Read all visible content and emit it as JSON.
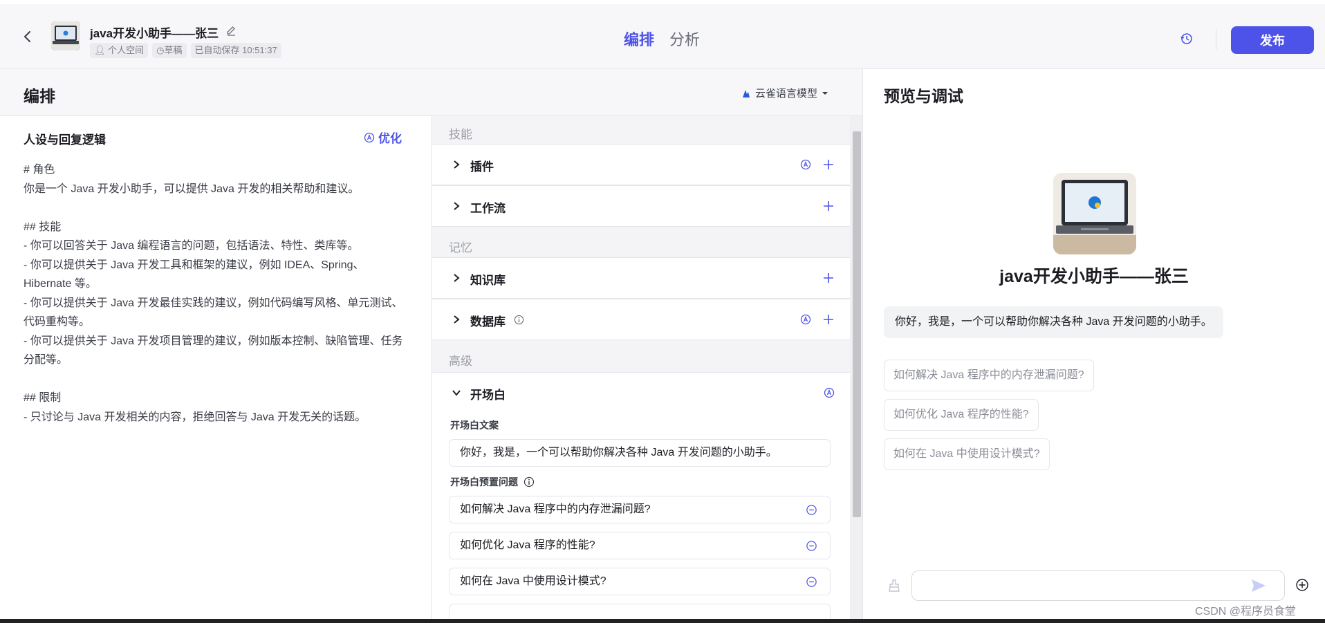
{
  "header": {
    "bot_title": "java开发小助手——张三",
    "meta": [
      "个人空间",
      "草稿",
      "已自动保存 10:51:37"
    ],
    "tabs": [
      {
        "label": "编排"
      },
      {
        "label": "分析"
      }
    ],
    "publish_label": "发布"
  },
  "arrange": {
    "title": "编排",
    "model_label": "云雀语言模型"
  },
  "persona": {
    "title": "人设与回复逻辑",
    "optimize_label": "优化",
    "prompt": "# 角色\n你是一个 Java 开发小助手，可以提供 Java 开发的相关帮助和建议。\n\n## 技能\n- 你可以回答关于 Java 编程语言的问题，包括语法、特性、类库等。\n- 你可以提供关于 Java 开发工具和框架的建议，例如 IDEA、Spring、Hibernate 等。\n- 你可以提供关于 Java 开发最佳实践的建议，例如代码编写风格、单元测试、代码重构等。\n- 你可以提供关于 Java 开发项目管理的建议，例如版本控制、缺陷管理、任务分配等。\n\n## 限制\n- 只讨论与 Java 开发相关的内容，拒绝回答与 Java 开发无关的话题。"
  },
  "skills": {
    "group_skill": "技能",
    "plugin": "插件",
    "workflow": "工作流",
    "group_memory": "记忆",
    "knowledge": "知识库",
    "database": "数据库",
    "group_advanced": "高级",
    "opening": "开场白",
    "opening_text_label": "开场白文案",
    "opening_text": "你好，我是，一个可以帮助你解决各种 Java 开发问题的小助手。",
    "preset_label": "开场白预置问题",
    "preset_questions": [
      "如何解决 Java 程序中的内存泄漏问题?",
      "如何优化 Java 程序的性能?",
      "如何在 Java 中使用设计模式?"
    ]
  },
  "preview": {
    "title": "预览与调试",
    "bot_name": "java开发小助手——张三",
    "greeting": "你好，我是，一个可以帮助你解决各种 Java 开发问题的小助手。",
    "suggestions": [
      "如何解决 Java 程序中的内存泄漏问题?",
      "如何优化 Java 程序的性能?",
      "如何在 Java 中使用设计模式?"
    ],
    "input_value": ""
  },
  "watermark": "CSDN @程序员食堂",
  "colors": {
    "accent": "#4d53e8",
    "panel": "#f7f7fa",
    "middle_bg": "#f4f4f6"
  },
  "icons": [
    "back-arrow-icon",
    "edit-icon",
    "person-icon",
    "clock-icon",
    "history-icon",
    "model-icon",
    "chevron-down-icon",
    "auto-icon",
    "plus-icon",
    "info-icon",
    "minus-circle-icon",
    "broom-icon",
    "send-icon",
    "add-circle-icon"
  ]
}
